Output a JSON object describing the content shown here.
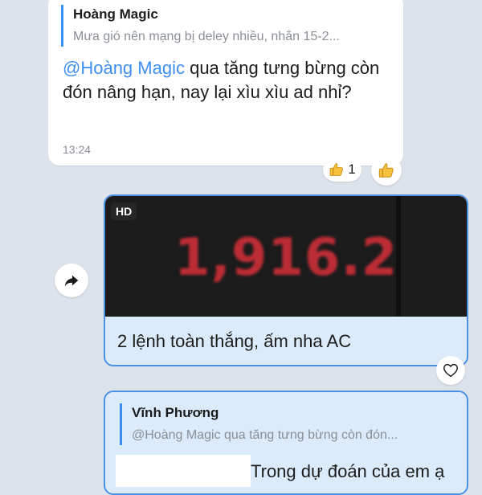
{
  "message_1": {
    "reply_author": "Hoàng Magic",
    "reply_snippet": "Mưa gió nên mạng bị deley nhiều, nhắn 15-2...",
    "mention": "@Hoàng Magic",
    "text": " qua tăng tưng bừng còn đón nâng hạn, nay lại xìu xìu ad nhỉ?",
    "time": "13:24",
    "reaction_icon": "thumbs-up-icon",
    "reaction_count": "1"
  },
  "message_2": {
    "badge": "HD",
    "media_value": "1,916.2",
    "caption": "2 lệnh toàn thắng, ấm nha AC"
  },
  "message_3": {
    "reply_author": "Vĩnh Phương",
    "reply_snippet": "@Hoàng Magic qua tăng tưng bừng còn đón...",
    "text": "Trong dự đoán của em ạ"
  },
  "colors": {
    "background": "#dde3ec",
    "accent": "#3d8ef0",
    "outgoing_bubble": "#dcebfb",
    "media_value": "#d8303a"
  }
}
